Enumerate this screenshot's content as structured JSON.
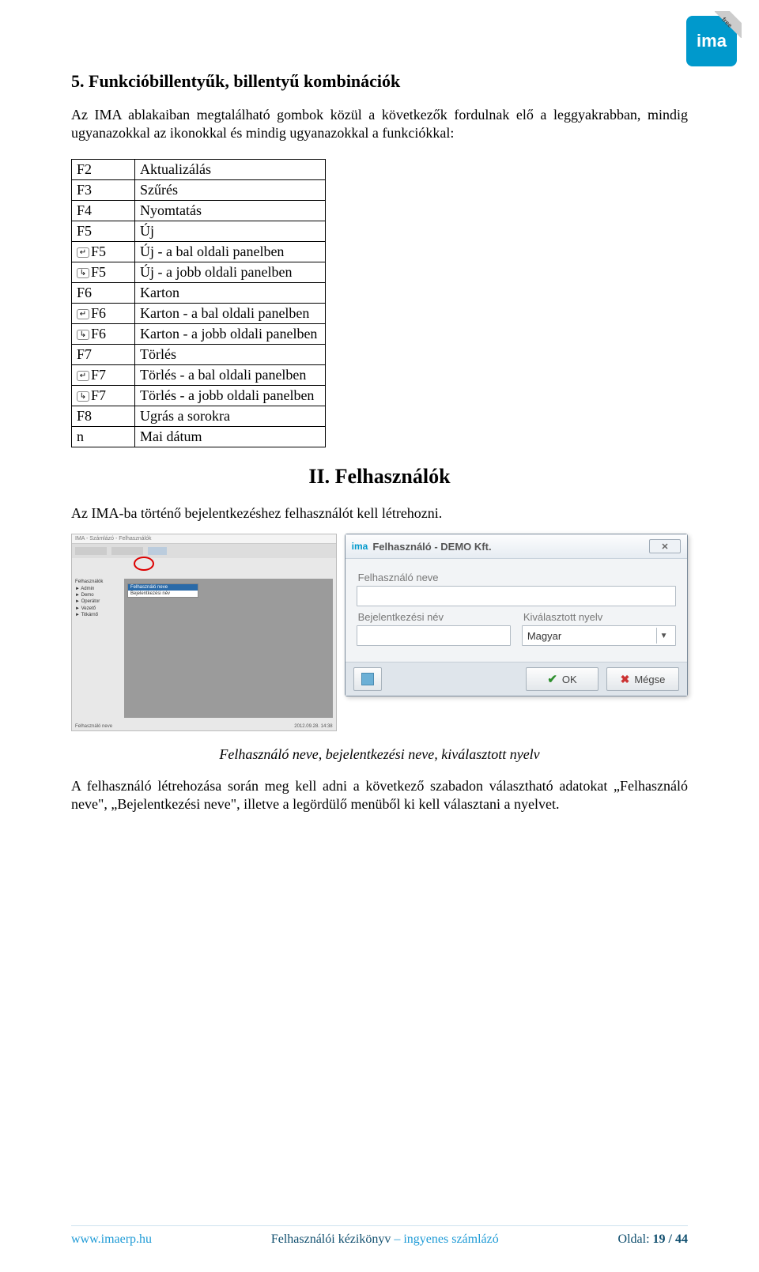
{
  "badge": {
    "logo_text": "ima",
    "ribbon": "free"
  },
  "section_title": "5. Funkcióbillentyűk, billentyű kombinációk",
  "intro": "Az IMA ablakaiban megtalálható gombok közül a következők fordulnak elő a leggyakrabban, mindig ugyanazokkal az ikonokkal és mindig ugyanazokkal a funkciókkal:",
  "keys": [
    {
      "key": "F2",
      "fn": "Aktualizálás",
      "glyph": ""
    },
    {
      "key": "F3",
      "fn": "Szűrés",
      "glyph": ""
    },
    {
      "key": "F4",
      "fn": "Nyomtatás",
      "glyph": ""
    },
    {
      "key": "F5",
      "fn": "Új",
      "glyph": ""
    },
    {
      "key": "F5",
      "fn": "Új - a bal oldali panelben",
      "glyph": "↵"
    },
    {
      "key": "F5",
      "fn": "Új - a jobb oldali panelben",
      "glyph": "↳"
    },
    {
      "key": "F6",
      "fn": "Karton",
      "glyph": ""
    },
    {
      "key": "F6",
      "fn": "Karton - a bal oldali panelben",
      "glyph": "↵"
    },
    {
      "key": "F6",
      "fn": "Karton - a jobb oldali panelben",
      "glyph": "↳"
    },
    {
      "key": "F7",
      "fn": "Törlés",
      "glyph": ""
    },
    {
      "key": "F7",
      "fn": "Törlés - a bal oldali panelben",
      "glyph": "↵"
    },
    {
      "key": "F7",
      "fn": "Törlés - a jobb oldali panelben",
      "glyph": "↳"
    },
    {
      "key": "F8",
      "fn": "Ugrás a sorokra",
      "glyph": ""
    },
    {
      "key": "n",
      "fn": "Mai dátum",
      "glyph": ""
    }
  ],
  "chapter_title": "II.   Felhasználók",
  "chapter_intro": "Az IMA-ba történő bejelentkezéshez felhasználót kell létrehozni.",
  "dialog": {
    "title": "Felhasználó  -  DEMO Kft.",
    "name_label": "Felhasználó neve",
    "login_label": "Bejelentkezési név",
    "lang_label": "Kiválasztott nyelv",
    "lang_value": "Magyar",
    "ok": "OK",
    "cancel": "Mégse"
  },
  "left_shot": {
    "titlebar": "IMA - Számlázó - Felhasználók",
    "status_left": "Felhasználó neve",
    "status_right": "2012.09.28. 14:38",
    "tree": [
      "Felhasználók",
      "► Admin",
      "► Demo",
      "► Operátor",
      "► Vezető",
      "► Titkárnő"
    ],
    "dropdown": [
      "Felhasználó neve",
      "Bejelentkezési név"
    ]
  },
  "caption": "Felhasználó neve, bejelentkezési neve, kiválasztott nyelv",
  "closing": "A felhasználó létrehozása során meg kell adni a következő szabadon választható adatokat „Felhasználó neve\", „Bejelentkezési neve\", illetve a legördülő menüből ki kell választani a nyelvet.",
  "footer": {
    "left": "www.imaerp.hu",
    "center_a": "Felhasználói kézikönyv",
    "center_b": " – ingyenes számlázó",
    "right_label": "Oldal:",
    "right_page": "19 / 44"
  }
}
